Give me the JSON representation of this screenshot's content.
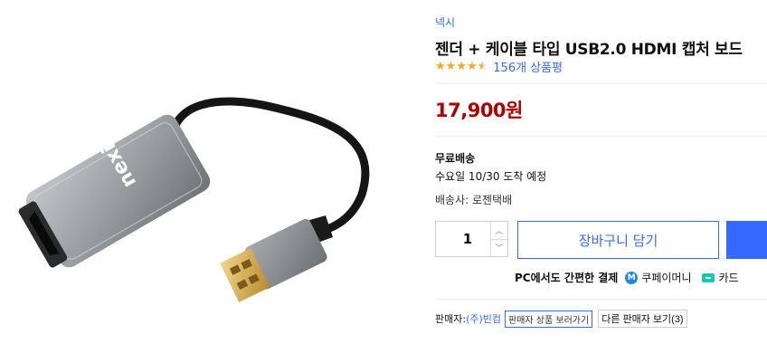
{
  "product": {
    "brand": "넥시",
    "title": "젠더 + 케이블 타입 USB2.0 HDMI 캡처 보드",
    "rating": 4.5,
    "review_count_label": "156개 상품평",
    "price": "17,900원",
    "image_logo": "nexi"
  },
  "shipping": {
    "title": "무료배송",
    "date": "수요일 10/30 도착 예정",
    "carrier": "배송사: 로젠택배"
  },
  "purchase": {
    "quantity": "1",
    "cart_label": "장바구니 담기"
  },
  "payment": {
    "text": "PC에서도 간편한 결제",
    "coupay_label": "쿠페이머니",
    "coupay_icon_letter": "M",
    "card_label": "카드"
  },
  "seller": {
    "label": "판매자: ",
    "name": "(주)빈컴",
    "view_products_label": "판매자 상품 보러가기",
    "other_sellers_label": "다른 판매자 보기(3)"
  },
  "colors": {
    "accent": "#346aff",
    "price": "#ae0000",
    "star": "#f5a623"
  }
}
